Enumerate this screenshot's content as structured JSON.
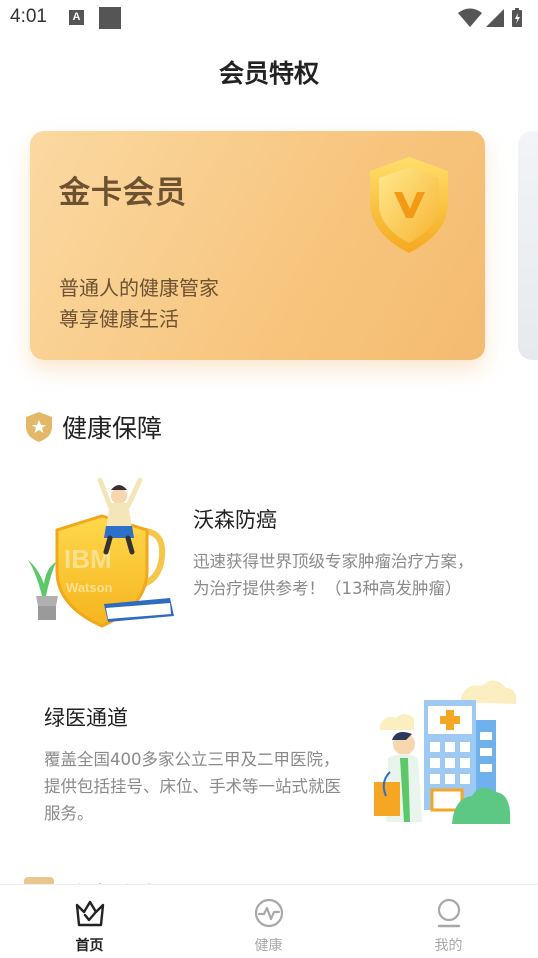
{
  "status_bar": {
    "time": "4:01",
    "notification_badge": "A"
  },
  "page": {
    "title": "会员特权"
  },
  "member_card": {
    "title": "金卡会员",
    "line1": "普通人的健康管家",
    "line2": "尊享健康生活",
    "badge_letter": "V",
    "gradient_start": "#fbd9a2",
    "gradient_end": "#f4bb70",
    "text_color": "#6d5232"
  },
  "section": {
    "title": "健康保障",
    "next_title": "健康约定"
  },
  "services": [
    {
      "title": "沃森防癌",
      "desc": "迅速获得世界顶级专家肿瘤治疗方案，为治疗提供参考！（13种高发肿瘤）",
      "illustration_text_1": "IBM",
      "illustration_text_2": "Watson",
      "icon": "ibm-watson-shield-illustration"
    },
    {
      "title": "绿医通道",
      "desc": "覆盖全国400多家公立三甲及二甲医院，提供包括挂号、床位、手术等一站式就医服务。",
      "icon": "hospital-doctor-illustration"
    }
  ],
  "tabbar": {
    "tabs": [
      {
        "label": "首页",
        "icon": "crown-icon",
        "active": true
      },
      {
        "label": "健康",
        "icon": "pulse-icon",
        "active": false
      },
      {
        "label": "我的",
        "icon": "person-icon",
        "active": false
      }
    ]
  }
}
